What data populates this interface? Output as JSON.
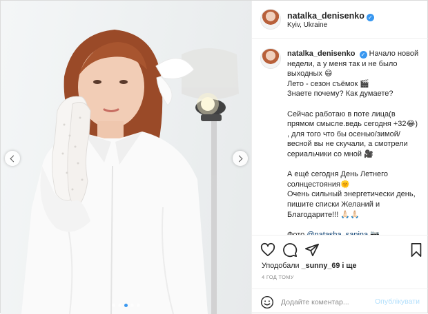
{
  "post": {
    "username": "natalka_denisenko",
    "location": "Kyiv, Ukraine",
    "caption_lines": [
      "Начало новой",
      "недели, а у меня так и не было",
      "выходных 😄",
      "Лето - сезон съёмок 🎬",
      "Знаете почему? Как думаете?",
      "",
      "Сейчас работаю в поте лица(в",
      "прямом смысле.ведь сегодня +32😂)",
      ", для того что бы осенью/зимой/",
      "весной вы не скучали, а смотрели",
      "сериальчики со мной 🎥",
      "",
      "А ещё сегодня День Летнего",
      "солнцестояния🌞",
      "Очень сильный энергетически день,",
      "пишите списки Желаний и",
      "Благодарите!!! 🙏🏻🙏🏻",
      "",
      "Фото @natasha_sanina 📷"
    ],
    "likes_prefix": "Уподобали",
    "likes_user": "_sunny_69",
    "likes_suffix": "і ще",
    "time_ago": "4 год тому",
    "comment_placeholder": "Додайте коментар...",
    "publish_label": "Опублікувати",
    "carousel": {
      "slide_count": 5,
      "active_index": 2
    }
  },
  "icons": {
    "verified": "verified-badge-icon",
    "like": "heart-icon",
    "comment": "speech-bubble-icon",
    "share": "paper-plane-icon",
    "save": "bookmark-icon",
    "emoji": "smiley-icon",
    "prev": "chevron-left-icon",
    "next": "chevron-right-icon"
  },
  "colors": {
    "accent_blue": "#3897f0",
    "publish_disabled": "#b2dffc",
    "text": "#262626",
    "muted": "#8e8e8e"
  }
}
